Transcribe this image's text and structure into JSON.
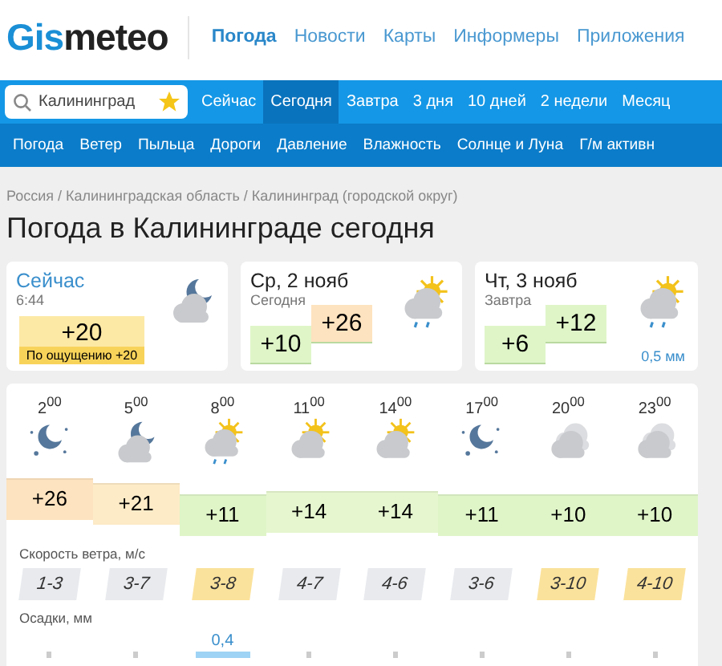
{
  "logo": {
    "accent": "Gis",
    "rest": "meteo"
  },
  "top_nav": [
    {
      "label": "Погода",
      "selected": true
    },
    {
      "label": "Новости",
      "selected": false
    },
    {
      "label": "Карты",
      "selected": false
    },
    {
      "label": "Информеры",
      "selected": false
    },
    {
      "label": "Приложения",
      "selected": false
    }
  ],
  "search": {
    "value": "Калининград",
    "favorite": true
  },
  "period_tabs": [
    {
      "label": "Сейчас",
      "selected": false
    },
    {
      "label": "Сегодня",
      "selected": true
    },
    {
      "label": "Завтра",
      "selected": false
    },
    {
      "label": "3 дня",
      "selected": false
    },
    {
      "label": "10 дней",
      "selected": false
    },
    {
      "label": "2 недели",
      "selected": false
    },
    {
      "label": "Месяц",
      "selected": false
    }
  ],
  "sub_nav": [
    "Погода",
    "Ветер",
    "Пыльца",
    "Дороги",
    "Давление",
    "Влажность",
    "Солнце и Луна",
    "Г/м активн"
  ],
  "breadcrumb": "Россия / Калининградская область / Калининград (городской округ)",
  "title": "Погода в Калининграде сегодня",
  "cards": [
    {
      "kind": "now",
      "heading": "Сейчас",
      "sub": "6:44",
      "temp": "+20",
      "feels": "По ощущению +20"
    },
    {
      "kind": "day",
      "heading": "Ср, 2 нояб",
      "sub": "Сегодня",
      "min": "+10",
      "max": {
        "value": "+26",
        "color": "#fde3bf"
      }
    },
    {
      "kind": "day",
      "heading": "Чт, 3 нояб",
      "sub": "Завтра",
      "min": "+6",
      "max": {
        "value": "+12",
        "color": "#dff5c8"
      },
      "precip": "0,5 мм"
    }
  ],
  "hours": [
    {
      "time": "2$^{00}$",
      "kind": "night",
      "temp": "+26",
      "color": "#fde3bf",
      "wind": {
        "value": "1-3",
        "color": "#e8eaee"
      }
    },
    {
      "time": "5$^{00}$",
      "kind": "overcast",
      "temp": "+21",
      "color": "#fdebc7",
      "wind": {
        "value": "3-7",
        "color": "#e8eaee"
      }
    },
    {
      "time": "8$^{00}$",
      "kind": "showers",
      "temp": "+11",
      "color": "#dff5c8",
      "wind": {
        "value": "3-8",
        "color": "#fbe29c"
      },
      "precip": "0,4"
    },
    {
      "time": "11$^{00}$",
      "kind": "partly",
      "temp": "+14",
      "color": "#e6f6cf",
      "wind": {
        "value": "4-7",
        "color": "#e8eaee"
      }
    },
    {
      "time": "14$^{00}$",
      "kind": "partly",
      "temp": "+14",
      "color": "#e6f6cf",
      "wind": {
        "value": "4-6",
        "color": "#e8eaee"
      }
    },
    {
      "time": "17$^{00}$",
      "kind": "night",
      "temp": "+11",
      "color": "#dff5c8",
      "wind": {
        "value": "3-6",
        "color": "#e8eaee"
      }
    },
    {
      "time": "20$^{00}$",
      "kind": "cloudy",
      "temp": "+10",
      "color": "#dff5c8",
      "wind": {
        "value": "3-10",
        "color": "#fbe29c"
      }
    },
    {
      "time": "23$^{00}$",
      "kind": "cloudy",
      "temp": "+10",
      "color": "#dff5c8",
      "wind": {
        "value": "4-10",
        "color": "#fbe29c"
      }
    }
  ],
  "wind_label": "Скорость ветра, м/с",
  "precip_label": "Осадки, мм"
}
